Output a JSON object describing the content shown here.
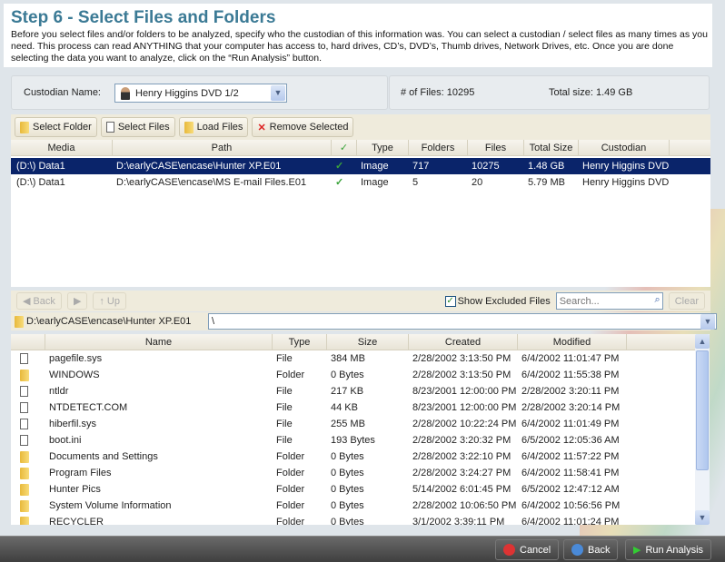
{
  "header": {
    "title": "Step 6 - Select Files and Folders",
    "description": "Before you select files and/or folders to be analyzed, specify who the custodian of this information was. You can select a custodian / select files as many times as you need. This process can read ANYTHING that your computer has access to, hard drives, CD’s, DVD’s, Thumb drives, Network Drives, etc. Once you are done selecting the data you want to analyze, click on the “Run Analysis” button."
  },
  "custodian": {
    "label": "Custodian Name:",
    "value": "Henry Higgins DVD 1/2"
  },
  "summary": {
    "files": "# of Files: 10295",
    "size": "Total size: 1.49 GB"
  },
  "toolbar": {
    "select_folder": "Select Folder",
    "select_files": "Select Files",
    "load_files": "Load Files",
    "remove_selected": "Remove Selected"
  },
  "sources": {
    "columns": [
      "Media",
      "Path",
      "✓",
      "Type",
      "Folders",
      "Files",
      "Total Size",
      "Custodian"
    ],
    "rows": [
      [
        "(D:\\) Data1",
        "D:\\earlyCASE\\encase\\Hunter XP.E01",
        "✓",
        "Image",
        "717",
        "10275",
        "1.48 GB",
        "Henry Higgins DVD 1/2"
      ],
      [
        "(D:\\) Data1",
        "D:\\earlyCASE\\encase\\MS E-mail Files.E01",
        "✓",
        "Image",
        "5",
        "20",
        "5.79 MB",
        "Henry Higgins DVD 1/2"
      ]
    ]
  },
  "browser": {
    "back": "Back",
    "up": "Up",
    "show_excluded": "Show Excluded Files",
    "search_placeholder": "Search...",
    "clear": "Clear",
    "source": "D:\\earlyCASE\\encase\\Hunter XP.E01",
    "path": "\\",
    "columns": [
      "Name",
      "Type",
      "Size",
      "Created",
      "Modified"
    ],
    "rows": [
      [
        "file",
        "pagefile.sys",
        "File",
        "384 MB",
        "2/28/2002 3:13:50 PM",
        "6/4/2002 11:01:47 PM"
      ],
      [
        "folder",
        "WINDOWS",
        "Folder",
        "0 Bytes",
        "2/28/2002 3:13:50 PM",
        "6/4/2002 11:55:38 PM"
      ],
      [
        "file",
        "ntldr",
        "File",
        "217 KB",
        "8/23/2001 12:00:00 PM",
        "2/28/2002 3:20:11 PM"
      ],
      [
        "file",
        "NTDETECT.COM",
        "File",
        "44 KB",
        "8/23/2001 12:00:00 PM",
        "2/28/2002 3:20:14 PM"
      ],
      [
        "file",
        "hiberfil.sys",
        "File",
        "255 MB",
        "2/28/2002 10:22:24 PM",
        "6/4/2002 11:01:49 PM"
      ],
      [
        "file",
        "boot.ini",
        "File",
        "193 Bytes",
        "2/28/2002 3:20:32 PM",
        "6/5/2002 12:05:36 AM"
      ],
      [
        "folder",
        "Documents and Settings",
        "Folder",
        "0 Bytes",
        "2/28/2002 3:22:10 PM",
        "6/4/2002 11:57:22 PM"
      ],
      [
        "folder",
        "Program Files",
        "Folder",
        "0 Bytes",
        "2/28/2002 3:24:27 PM",
        "6/4/2002 11:58:41 PM"
      ],
      [
        "folder",
        "Hunter Pics",
        "Folder",
        "0 Bytes",
        "5/14/2002 6:01:45 PM",
        "6/5/2002 12:47:12 AM"
      ],
      [
        "folder",
        "System Volume Information",
        "Folder",
        "0 Bytes",
        "2/28/2002 10:06:50 PM",
        "6/4/2002 10:56:56 PM"
      ],
      [
        "folder",
        "RECYCLER",
        "Folder",
        "0 Bytes",
        "3/1/2002 3:39:11 PM",
        "6/4/2002 11:01:24 PM"
      ]
    ]
  },
  "footer": {
    "cancel": "Cancel",
    "back": "Back",
    "run": "Run Analysis"
  }
}
